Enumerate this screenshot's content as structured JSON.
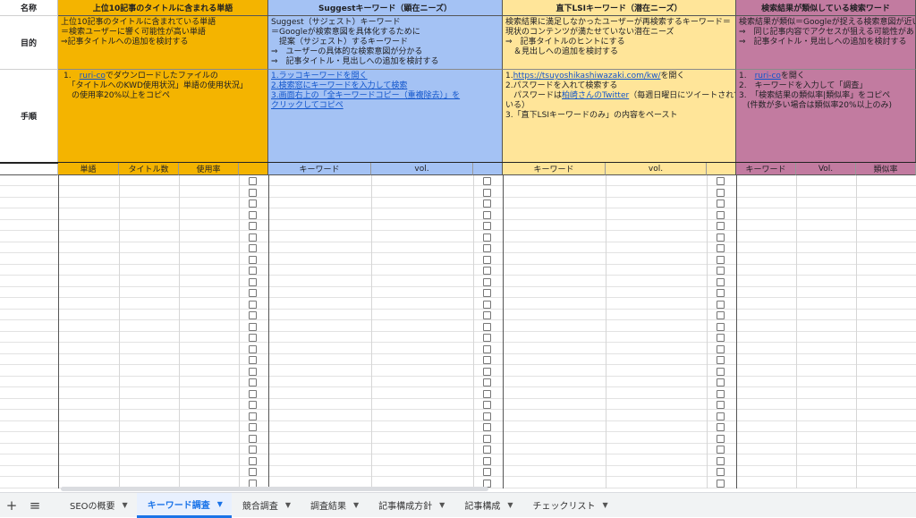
{
  "row_labels": {
    "name": "名称",
    "purpose": "目的",
    "steps": "手順"
  },
  "colors": {
    "orange": "#f4b400",
    "blue": "#a4c2f4",
    "yellow": "#ffe599",
    "pink": "#c27ba0",
    "link": "#1155cc",
    "active_tab": "#1a73e8"
  },
  "sections": [
    {
      "title": "上位10記事のタイトルに含まれる単語",
      "purpose": [
        "上位10記事のタイトルに含まれている単語",
        "＝検索ユーザーに響く可能性が高い単語",
        "⇒記事タイトルへの追加を検討する"
      ],
      "steps_1_prefix": "1.　",
      "steps_1_link": "ruri-co",
      "steps_1_suffix": "でダウンロードしたファイルの",
      "steps_2": "　「タイトルへのKWD使用状況」単語の使用状況」",
      "steps_3": "　の使用率20%以上をコピペ",
      "columns": [
        "単語",
        "タイトル数",
        "使用率"
      ]
    },
    {
      "title": "Suggestキーワード（顕在ニーズ）",
      "purpose": [
        "Suggest（サジェスト）キーワード",
        "＝Googleが検索意図を具体化するために",
        "　提案（サジェスト）するキーワード",
        "⇒　ユーザーの具体的な検索意図が分かる",
        "⇒　記事タイトル・見出しへの追加を検討する"
      ],
      "steps": [
        "1.ラッコキーワードを開く",
        "2.検索窓にキーワードを入力して検索",
        "3.画面右上の「全キーワードコピー（重複除去）」を",
        "クリックしてコピペ"
      ],
      "columns": [
        "キーワード",
        "vol."
      ]
    },
    {
      "title": "直下LSIキーワード（潜在ニーズ）",
      "purpose": [
        "検索結果に満足しなかったユーザーが再検索するキーワード＝",
        "現状のコンテンツが満たせていない潜在ニーズ",
        "⇒　記事タイトルのヒントにする",
        "　＆見出しへの追加を検討する"
      ],
      "steps_1_prefix": "1.",
      "steps_1_link": "https://tsuyoshikashiwazaki.com/kw/",
      "steps_1_suffix": "を開く",
      "steps_2": "2.パスワードを入れて検索する",
      "steps_3_prefix": "　パスワードは",
      "steps_3_link": "柏崎さんのTwitter",
      "steps_3_suffix": "（毎週日曜日にツイートされて",
      "steps_4": "いる）",
      "steps_5": "3.「直下LSIキーワードのみ」の内容をペースト",
      "columns": [
        "キーワード",
        "vol."
      ]
    },
    {
      "title": "検索結果が類似している検索ワード",
      "purpose": [
        "検索結果が類似＝Googleが捉える検索意図が近い",
        "⇒　同じ記事内容でアクセスが狙える可能性があ",
        "⇒　記事タイトル・見出しへの追加を検討する"
      ],
      "steps_1_prefix": "1.　",
      "steps_1_link": "ruri-co",
      "steps_1_suffix": "を開く",
      "steps_2": "2.　キーワードを入力して「調査」",
      "steps_3": "3.　「検索結果の類似率|類似率」をコピペ",
      "steps_4": "　(件数が多い場合は類似率20%以上のみ)",
      "columns": [
        "キーワード",
        "Vol.",
        "類似率"
      ]
    }
  ],
  "toolbar": {
    "add_icon": "+",
    "menu_icon": "≡"
  },
  "tabs": [
    {
      "label": "SEOの概要",
      "active": false
    },
    {
      "label": "キーワード調査",
      "active": true
    },
    {
      "label": "競合調査",
      "active": false
    },
    {
      "label": "調査結果",
      "active": false
    },
    {
      "label": "記事構成方針",
      "active": false
    },
    {
      "label": "記事構成",
      "active": false
    },
    {
      "label": "チェックリスト",
      "active": false
    }
  ],
  "caret_icon": "▼"
}
